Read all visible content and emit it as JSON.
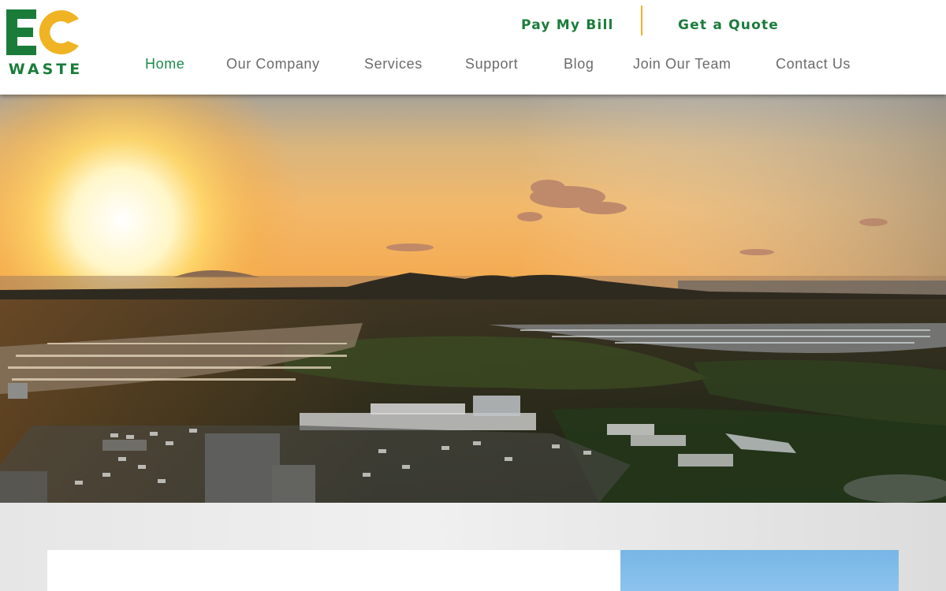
{
  "brand": {
    "logo_letters": "EC",
    "logo_word": "WASTE",
    "colors": {
      "green": "#1b7c3a",
      "yellow": "#f0b323"
    }
  },
  "top_links": {
    "pay_bill": "Pay My Bill",
    "get_quote": "Get a Quote"
  },
  "nav": {
    "active": "Home",
    "items": [
      {
        "label": "Home"
      },
      {
        "label": "Our Company"
      },
      {
        "label": "Services"
      },
      {
        "label": "Support"
      },
      {
        "label": "Blog"
      },
      {
        "label": "Join Our Team"
      },
      {
        "label": "Contact Us"
      }
    ]
  },
  "hero": {
    "image": "aerial sunset over industrial area, hills and sea"
  }
}
